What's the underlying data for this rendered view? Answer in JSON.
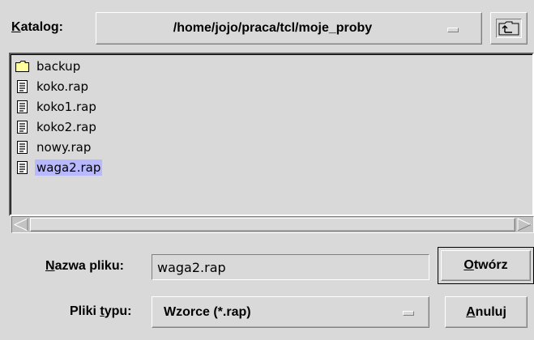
{
  "directory": {
    "label_first": "K",
    "label_rest": "atalog:",
    "current_path": "/home/jojo/praca/tcl/moje_proby"
  },
  "files": [
    {
      "name": "backup",
      "icon": "folder-icon",
      "selected": false
    },
    {
      "name": "koko.rap",
      "icon": "file-icon",
      "selected": false
    },
    {
      "name": "koko1.rap",
      "icon": "file-icon",
      "selected": false
    },
    {
      "name": "koko2.rap",
      "icon": "file-icon",
      "selected": false
    },
    {
      "name": "nowy.rap",
      "icon": "file-icon",
      "selected": false
    },
    {
      "name": "waga2.rap",
      "icon": "file-icon",
      "selected": true
    }
  ],
  "filename": {
    "label_first": "N",
    "label_rest": "azwa pliku:",
    "value": "waga2.rap"
  },
  "filetype": {
    "label_pre": "Pliki ",
    "label_ul": "t",
    "label_rest": "ypu:",
    "selected": "Wzorce (*.rap)"
  },
  "buttons": {
    "open_first": "O",
    "open_rest": "twórz",
    "cancel_first": "A",
    "cancel_rest": "nuluj"
  },
  "colors": {
    "background": "#d9d9d9",
    "selection": "#b8b8ff",
    "folder": "#ffff9f"
  }
}
